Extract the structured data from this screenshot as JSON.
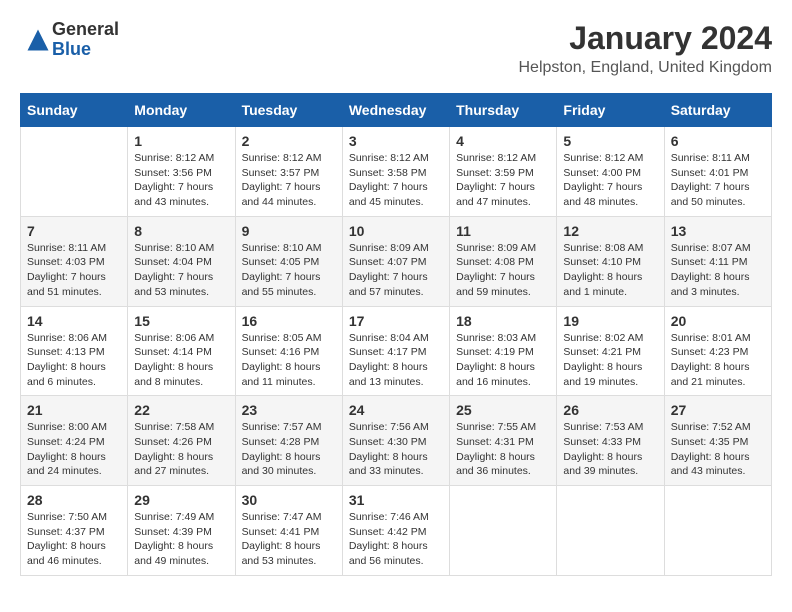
{
  "logo": {
    "general": "General",
    "blue": "Blue"
  },
  "header": {
    "month_year": "January 2024",
    "location": "Helpston, England, United Kingdom"
  },
  "weekdays": [
    "Sunday",
    "Monday",
    "Tuesday",
    "Wednesday",
    "Thursday",
    "Friday",
    "Saturday"
  ],
  "weeks": [
    [
      {
        "day": "",
        "sunrise": "",
        "sunset": "",
        "daylight": ""
      },
      {
        "day": "1",
        "sunrise": "Sunrise: 8:12 AM",
        "sunset": "Sunset: 3:56 PM",
        "daylight": "Daylight: 7 hours and 43 minutes."
      },
      {
        "day": "2",
        "sunrise": "Sunrise: 8:12 AM",
        "sunset": "Sunset: 3:57 PM",
        "daylight": "Daylight: 7 hours and 44 minutes."
      },
      {
        "day": "3",
        "sunrise": "Sunrise: 8:12 AM",
        "sunset": "Sunset: 3:58 PM",
        "daylight": "Daylight: 7 hours and 45 minutes."
      },
      {
        "day": "4",
        "sunrise": "Sunrise: 8:12 AM",
        "sunset": "Sunset: 3:59 PM",
        "daylight": "Daylight: 7 hours and 47 minutes."
      },
      {
        "day": "5",
        "sunrise": "Sunrise: 8:12 AM",
        "sunset": "Sunset: 4:00 PM",
        "daylight": "Daylight: 7 hours and 48 minutes."
      },
      {
        "day": "6",
        "sunrise": "Sunrise: 8:11 AM",
        "sunset": "Sunset: 4:01 PM",
        "daylight": "Daylight: 7 hours and 50 minutes."
      }
    ],
    [
      {
        "day": "7",
        "sunrise": "Sunrise: 8:11 AM",
        "sunset": "Sunset: 4:03 PM",
        "daylight": "Daylight: 7 hours and 51 minutes."
      },
      {
        "day": "8",
        "sunrise": "Sunrise: 8:10 AM",
        "sunset": "Sunset: 4:04 PM",
        "daylight": "Daylight: 7 hours and 53 minutes."
      },
      {
        "day": "9",
        "sunrise": "Sunrise: 8:10 AM",
        "sunset": "Sunset: 4:05 PM",
        "daylight": "Daylight: 7 hours and 55 minutes."
      },
      {
        "day": "10",
        "sunrise": "Sunrise: 8:09 AM",
        "sunset": "Sunset: 4:07 PM",
        "daylight": "Daylight: 7 hours and 57 minutes."
      },
      {
        "day": "11",
        "sunrise": "Sunrise: 8:09 AM",
        "sunset": "Sunset: 4:08 PM",
        "daylight": "Daylight: 7 hours and 59 minutes."
      },
      {
        "day": "12",
        "sunrise": "Sunrise: 8:08 AM",
        "sunset": "Sunset: 4:10 PM",
        "daylight": "Daylight: 8 hours and 1 minute."
      },
      {
        "day": "13",
        "sunrise": "Sunrise: 8:07 AM",
        "sunset": "Sunset: 4:11 PM",
        "daylight": "Daylight: 8 hours and 3 minutes."
      }
    ],
    [
      {
        "day": "14",
        "sunrise": "Sunrise: 8:06 AM",
        "sunset": "Sunset: 4:13 PM",
        "daylight": "Daylight: 8 hours and 6 minutes."
      },
      {
        "day": "15",
        "sunrise": "Sunrise: 8:06 AM",
        "sunset": "Sunset: 4:14 PM",
        "daylight": "Daylight: 8 hours and 8 minutes."
      },
      {
        "day": "16",
        "sunrise": "Sunrise: 8:05 AM",
        "sunset": "Sunset: 4:16 PM",
        "daylight": "Daylight: 8 hours and 11 minutes."
      },
      {
        "day": "17",
        "sunrise": "Sunrise: 8:04 AM",
        "sunset": "Sunset: 4:17 PM",
        "daylight": "Daylight: 8 hours and 13 minutes."
      },
      {
        "day": "18",
        "sunrise": "Sunrise: 8:03 AM",
        "sunset": "Sunset: 4:19 PM",
        "daylight": "Daylight: 8 hours and 16 minutes."
      },
      {
        "day": "19",
        "sunrise": "Sunrise: 8:02 AM",
        "sunset": "Sunset: 4:21 PM",
        "daylight": "Daylight: 8 hours and 19 minutes."
      },
      {
        "day": "20",
        "sunrise": "Sunrise: 8:01 AM",
        "sunset": "Sunset: 4:23 PM",
        "daylight": "Daylight: 8 hours and 21 minutes."
      }
    ],
    [
      {
        "day": "21",
        "sunrise": "Sunrise: 8:00 AM",
        "sunset": "Sunset: 4:24 PM",
        "daylight": "Daylight: 8 hours and 24 minutes."
      },
      {
        "day": "22",
        "sunrise": "Sunrise: 7:58 AM",
        "sunset": "Sunset: 4:26 PM",
        "daylight": "Daylight: 8 hours and 27 minutes."
      },
      {
        "day": "23",
        "sunrise": "Sunrise: 7:57 AM",
        "sunset": "Sunset: 4:28 PM",
        "daylight": "Daylight: 8 hours and 30 minutes."
      },
      {
        "day": "24",
        "sunrise": "Sunrise: 7:56 AM",
        "sunset": "Sunset: 4:30 PM",
        "daylight": "Daylight: 8 hours and 33 minutes."
      },
      {
        "day": "25",
        "sunrise": "Sunrise: 7:55 AM",
        "sunset": "Sunset: 4:31 PM",
        "daylight": "Daylight: 8 hours and 36 minutes."
      },
      {
        "day": "26",
        "sunrise": "Sunrise: 7:53 AM",
        "sunset": "Sunset: 4:33 PM",
        "daylight": "Daylight: 8 hours and 39 minutes."
      },
      {
        "day": "27",
        "sunrise": "Sunrise: 7:52 AM",
        "sunset": "Sunset: 4:35 PM",
        "daylight": "Daylight: 8 hours and 43 minutes."
      }
    ],
    [
      {
        "day": "28",
        "sunrise": "Sunrise: 7:50 AM",
        "sunset": "Sunset: 4:37 PM",
        "daylight": "Daylight: 8 hours and 46 minutes."
      },
      {
        "day": "29",
        "sunrise": "Sunrise: 7:49 AM",
        "sunset": "Sunset: 4:39 PM",
        "daylight": "Daylight: 8 hours and 49 minutes."
      },
      {
        "day": "30",
        "sunrise": "Sunrise: 7:47 AM",
        "sunset": "Sunset: 4:41 PM",
        "daylight": "Daylight: 8 hours and 53 minutes."
      },
      {
        "day": "31",
        "sunrise": "Sunrise: 7:46 AM",
        "sunset": "Sunset: 4:42 PM",
        "daylight": "Daylight: 8 hours and 56 minutes."
      },
      {
        "day": "",
        "sunrise": "",
        "sunset": "",
        "daylight": ""
      },
      {
        "day": "",
        "sunrise": "",
        "sunset": "",
        "daylight": ""
      },
      {
        "day": "",
        "sunrise": "",
        "sunset": "",
        "daylight": ""
      }
    ]
  ]
}
